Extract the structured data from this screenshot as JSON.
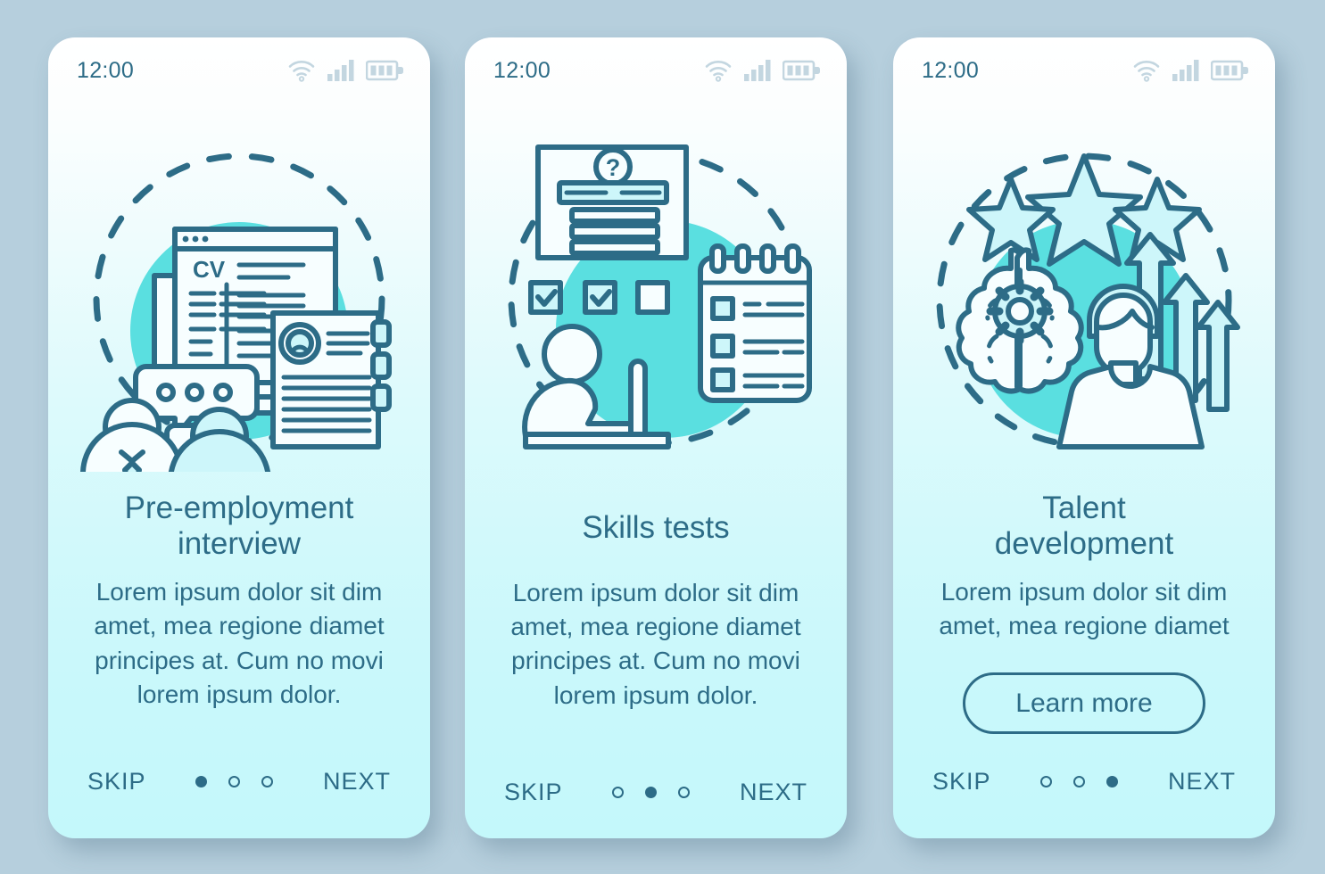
{
  "palette": {
    "page_bg": "#b6cfdd",
    "card_top": "#ffffff",
    "card_bottom": "#c4f8fb",
    "ink": "#2d6c87",
    "teal_circle": "#5adfe0",
    "pale_cyan": "#cdf6fa",
    "status_icon": "#c3d6e0"
  },
  "screens": [
    {
      "id": "pre-employment-interview",
      "status": {
        "time": "12:00",
        "icons": [
          "wifi-icon",
          "signal-icon",
          "battery-icon"
        ]
      },
      "illustration": "interview-illustration",
      "title": "Pre-employment\ninterview",
      "body": "Lorem ipsum dolor sit dim amet, mea regione diamet principes at. Cum no movi lorem ipsum dolor.",
      "cta": null,
      "nav": {
        "skip": "SKIP",
        "next": "NEXT",
        "dot_count": 3,
        "active_dot": 0
      }
    },
    {
      "id": "skills-tests",
      "status": {
        "time": "12:00",
        "icons": [
          "wifi-icon",
          "signal-icon",
          "battery-icon"
        ]
      },
      "illustration": "skills-test-illustration",
      "title": "Skills tests",
      "body": "Lorem ipsum dolor sit dim amet, mea regione diamet principes at. Cum no movi lorem ipsum dolor.",
      "cta": null,
      "nav": {
        "skip": "SKIP",
        "next": "NEXT",
        "dot_count": 3,
        "active_dot": 1
      }
    },
    {
      "id": "talent-development",
      "status": {
        "time": "12:00",
        "icons": [
          "wifi-icon",
          "signal-icon",
          "battery-icon"
        ]
      },
      "illustration": "talent-development-illustration",
      "title": "Talent\ndevelopment",
      "body": "Lorem ipsum dolor sit dim amet, mea regione diamet",
      "cta": "Learn more",
      "nav": {
        "skip": "SKIP",
        "next": "NEXT",
        "dot_count": 3,
        "active_dot": 2
      }
    }
  ],
  "illustration_labels": {
    "cv_screen_text": "CV"
  }
}
